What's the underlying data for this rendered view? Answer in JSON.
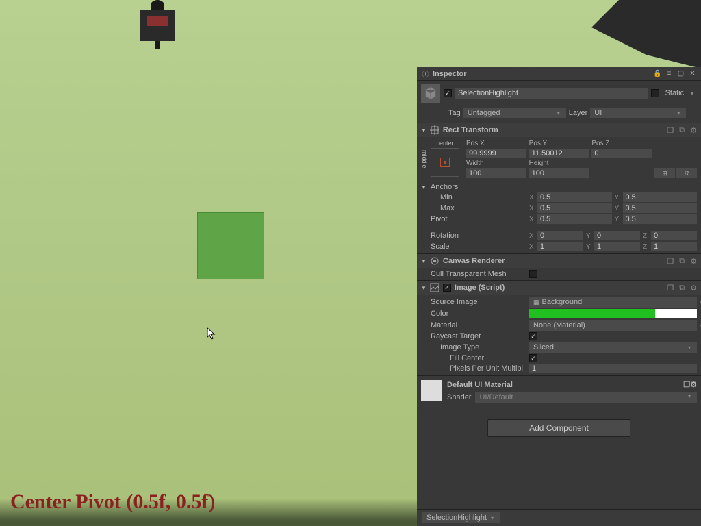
{
  "caption": "Center Pivot (0.5f, 0.5f)",
  "inspector": {
    "title": "Inspector",
    "objectEnabled": true,
    "objectName": "SelectionHighlight",
    "staticLabel": "Static",
    "tagLabel": "Tag",
    "tagValue": "Untagged",
    "layerLabel": "Layer",
    "layerValue": "UI"
  },
  "rectTransform": {
    "title": "Rect Transform",
    "presetH": "center",
    "presetV": "middle",
    "posXLabel": "Pos X",
    "posX": "99.9999",
    "posYLabel": "Pos Y",
    "posY": "11.50012",
    "posZLabel": "Pos Z",
    "posZ": "0",
    "widthLabel": "Width",
    "width": "100",
    "heightLabel": "Height",
    "height": "100",
    "rBtn": "R",
    "anchorsLabel": "Anchors",
    "minLabel": "Min",
    "min": {
      "x": "0.5",
      "y": "0.5"
    },
    "maxLabel": "Max",
    "max": {
      "x": "0.5",
      "y": "0.5"
    },
    "pivotLabel": "Pivot",
    "pivot": {
      "x": "0.5",
      "y": "0.5"
    },
    "rotationLabel": "Rotation",
    "rotation": {
      "x": "0",
      "y": "0",
      "z": "0"
    },
    "scaleLabel": "Scale",
    "scale": {
      "x": "1",
      "y": "1",
      "z": "1"
    }
  },
  "canvasRenderer": {
    "title": "Canvas Renderer",
    "cullLabel": "Cull Transparent Mesh",
    "cullValue": false
  },
  "image": {
    "title": "Image (Script)",
    "sourceLabel": "Source Image",
    "sourceValue": "Background",
    "colorLabel": "Color",
    "materialLabel": "Material",
    "materialValue": "None (Material)",
    "raycastLabel": "Raycast Target",
    "raycastValue": true,
    "imageTypeLabel": "Image Type",
    "imageTypeValue": "Sliced",
    "fillCenterLabel": "Fill Center",
    "fillCenterValue": true,
    "ppuLabel": "Pixels Per Unit Multipl",
    "ppuValue": "1"
  },
  "material": {
    "title": "Default UI Material",
    "shaderLabel": "Shader",
    "shaderValue": "UI/Default"
  },
  "addComponent": "Add Component",
  "footer": {
    "crumb": "SelectionHighlight"
  }
}
